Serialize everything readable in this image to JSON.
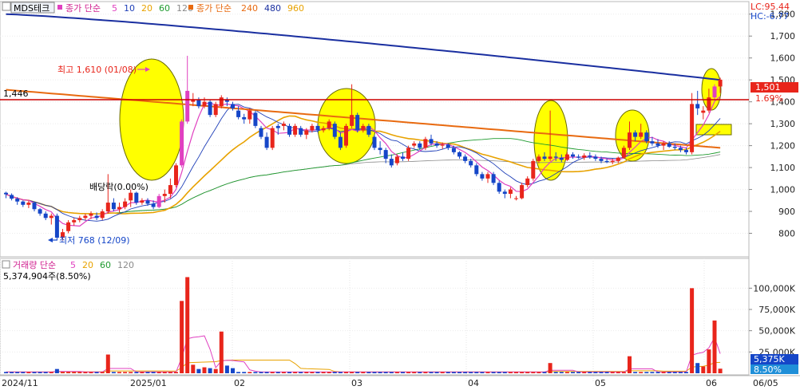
{
  "price_legend": {
    "name": "MDS테크",
    "ma_label": "종가 단순",
    "ma_periods": [
      "5",
      "10",
      "20",
      "60",
      "120"
    ],
    "ma_label_2": "종가 단순",
    "ma_periods_2": [
      "240",
      "480",
      "960"
    ]
  },
  "volume_legend": {
    "label": "거래량 단순",
    "periods": [
      "5",
      "20",
      "60",
      "120"
    ],
    "current": "5,374,904주(8.50%)"
  },
  "top_right": {
    "lc": "LC:95.44",
    "hc": "HC:-6.77"
  },
  "annotations": {
    "high": "최고 1,610 (01/08)",
    "low": "최저 768 (12/09)",
    "dividend": "배당락(0.00%)",
    "hline_label": "1,446"
  },
  "badges": {
    "price": "1,501",
    "pct": "1.69%",
    "vol": "5,375K",
    "vol_pct": "8.50%"
  },
  "colors": {
    "up": "#e8251b",
    "down": "#1546c8",
    "dividend_up": "#e040c0",
    "ma5": "#e040c0",
    "ma10": "#1f3fb8",
    "ma20": "#e8a200",
    "ma60": "#1e9a2e",
    "ma120": "#8a8a8a",
    "ma240": "#e86a10",
    "ma480": "#1a2fa0",
    "hline": "#cc0000",
    "highlight": "#ffff00"
  },
  "chart_data": {
    "type": "candlestick",
    "price_axis": {
      "min": 700,
      "max": 1850,
      "ticks": [
        "800",
        "900",
        "1,000",
        "1,100",
        "1,200",
        "1,300",
        "1,400",
        "1,500",
        "1,600",
        "1,700",
        "1,800"
      ]
    },
    "volume_axis": {
      "min": 0,
      "max": 120000,
      "ticks": [
        "25,000K",
        "50,000K",
        "75,000K",
        "100,000K"
      ]
    },
    "x_ticks": [
      "2024/11",
      "2025/01",
      "02",
      "03",
      "04",
      "05",
      "06",
      "06/05"
    ],
    "horizontal_line": 1446,
    "ohlc": [
      [
        985,
        990,
        960,
        978
      ],
      [
        975,
        982,
        950,
        958
      ],
      [
        958,
        965,
        930,
        945
      ],
      [
        945,
        950,
        920,
        930
      ],
      [
        930,
        948,
        915,
        940
      ],
      [
        940,
        945,
        900,
        910
      ],
      [
        910,
        915,
        880,
        890
      ],
      [
        890,
        900,
        860,
        870
      ],
      [
        870,
        890,
        840,
        880
      ],
      [
        880,
        890,
        770,
        780
      ],
      [
        780,
        820,
        768,
        805
      ],
      [
        810,
        860,
        800,
        850
      ],
      [
        850,
        870,
        835,
        860
      ],
      [
        860,
        880,
        850,
        870
      ],
      [
        870,
        890,
        860,
        880
      ],
      [
        880,
        900,
        865,
        890
      ],
      [
        880,
        895,
        860,
        870
      ],
      [
        870,
        910,
        860,
        900
      ],
      [
        900,
        1070,
        890,
        940
      ],
      [
        940,
        960,
        900,
        910
      ],
      [
        910,
        940,
        895,
        920
      ],
      [
        920,
        960,
        910,
        945
      ],
      [
        950,
        1000,
        920,
        985
      ],
      [
        985,
        990,
        930,
        940
      ],
      [
        940,
        960,
        930,
        950
      ],
      [
        950,
        960,
        925,
        935
      ],
      [
        935,
        950,
        910,
        920
      ],
      [
        920,
        980,
        915,
        970
      ],
      [
        970,
        1000,
        940,
        980
      ],
      [
        980,
        1050,
        960,
        1020
      ],
      [
        1020,
        1120,
        1010,
        1110
      ],
      [
        1110,
        1320,
        1100,
        1310
      ],
      [
        1310,
        1610,
        1300,
        1450
      ],
      [
        1400,
        1440,
        1380,
        1410
      ],
      [
        1410,
        1420,
        1370,
        1380
      ],
      [
        1380,
        1420,
        1370,
        1400
      ],
      [
        1400,
        1410,
        1330,
        1340
      ],
      [
        1340,
        1400,
        1330,
        1390
      ],
      [
        1380,
        1430,
        1370,
        1420
      ],
      [
        1410,
        1420,
        1380,
        1400
      ],
      [
        1390,
        1400,
        1360,
        1370
      ],
      [
        1360,
        1380,
        1320,
        1330
      ],
      [
        1330,
        1345,
        1300,
        1320
      ],
      [
        1320,
        1370,
        1300,
        1360
      ],
      [
        1350,
        1360,
        1280,
        1290
      ],
      [
        1280,
        1290,
        1230,
        1240
      ],
      [
        1240,
        1260,
        1180,
        1190
      ],
      [
        1190,
        1290,
        1180,
        1280
      ],
      [
        1290,
        1300,
        1250,
        1280
      ],
      [
        1290,
        1310,
        1270,
        1300
      ],
      [
        1290,
        1300,
        1240,
        1250
      ],
      [
        1250,
        1300,
        1240,
        1290
      ],
      [
        1280,
        1290,
        1240,
        1250
      ],
      [
        1250,
        1280,
        1230,
        1270
      ],
      [
        1270,
        1300,
        1260,
        1290
      ],
      [
        1290,
        1300,
        1260,
        1270
      ],
      [
        1270,
        1290,
        1260,
        1280
      ],
      [
        1280,
        1320,
        1270,
        1310
      ],
      [
        1300,
        1310,
        1230,
        1240
      ],
      [
        1240,
        1260,
        1180,
        1190
      ],
      [
        1200,
        1300,
        1190,
        1290
      ],
      [
        1290,
        1480,
        1280,
        1340
      ],
      [
        1340,
        1350,
        1260,
        1270
      ],
      [
        1270,
        1300,
        1260,
        1290
      ],
      [
        1290,
        1300,
        1240,
        1250
      ],
      [
        1240,
        1250,
        1180,
        1190
      ],
      [
        1190,
        1220,
        1160,
        1180
      ],
      [
        1180,
        1190,
        1120,
        1140
      ],
      [
        1140,
        1160,
        1100,
        1110
      ],
      [
        1120,
        1160,
        1110,
        1150
      ],
      [
        1150,
        1170,
        1130,
        1140
      ],
      [
        1140,
        1200,
        1130,
        1190
      ],
      [
        1200,
        1220,
        1190,
        1210
      ],
      [
        1210,
        1220,
        1180,
        1190
      ],
      [
        1190,
        1240,
        1180,
        1230
      ],
      [
        1230,
        1250,
        1200,
        1210
      ],
      [
        1210,
        1220,
        1190,
        1200
      ],
      [
        1200,
        1215,
        1185,
        1205
      ],
      [
        1205,
        1210,
        1180,
        1190
      ],
      [
        1190,
        1200,
        1160,
        1170
      ],
      [
        1170,
        1175,
        1140,
        1150
      ],
      [
        1150,
        1160,
        1120,
        1130
      ],
      [
        1130,
        1140,
        1100,
        1110
      ],
      [
        1110,
        1120,
        1060,
        1070
      ],
      [
        1070,
        1080,
        1040,
        1050
      ],
      [
        1050,
        1080,
        1030,
        1070
      ],
      [
        1070,
        1080,
        1020,
        1030
      ],
      [
        1030,
        1040,
        980,
        990
      ],
      [
        990,
        1000,
        960,
        980
      ],
      [
        980,
        1010,
        960,
        1000
      ],
      [
        960,
        970,
        950,
        960
      ],
      [
        960,
        1030,
        955,
        1020
      ],
      [
        1020,
        1060,
        1010,
        1050
      ],
      [
        1050,
        1140,
        1040,
        1130
      ],
      [
        1130,
        1160,
        1120,
        1150
      ],
      [
        1150,
        1170,
        1130,
        1140
      ],
      [
        1140,
        1360,
        1130,
        1150
      ],
      [
        1150,
        1170,
        1130,
        1145
      ],
      [
        1145,
        1160,
        1125,
        1135
      ],
      [
        1135,
        1170,
        1130,
        1160
      ],
      [
        1160,
        1170,
        1140,
        1150
      ],
      [
        1150,
        1160,
        1140,
        1145
      ],
      [
        1145,
        1165,
        1135,
        1155
      ],
      [
        1155,
        1170,
        1140,
        1150
      ],
      [
        1150,
        1160,
        1130,
        1140
      ],
      [
        1140,
        1150,
        1120,
        1130
      ],
      [
        1130,
        1140,
        1120,
        1125
      ],
      [
        1125,
        1140,
        1115,
        1130
      ],
      [
        1130,
        1150,
        1120,
        1145
      ],
      [
        1145,
        1200,
        1140,
        1190
      ],
      [
        1190,
        1310,
        1180,
        1260
      ],
      [
        1260,
        1270,
        1220,
        1240
      ],
      [
        1240,
        1300,
        1230,
        1260
      ],
      [
        1260,
        1270,
        1210,
        1220
      ],
      [
        1220,
        1240,
        1200,
        1210
      ],
      [
        1210,
        1230,
        1190,
        1200
      ],
      [
        1200,
        1220,
        1180,
        1210
      ],
      [
        1210,
        1220,
        1190,
        1195
      ],
      [
        1195,
        1210,
        1180,
        1190
      ],
      [
        1190,
        1200,
        1170,
        1180
      ],
      [
        1180,
        1190,
        1160,
        1170
      ],
      [
        1170,
        1440,
        1160,
        1390
      ],
      [
        1390,
        1450,
        1340,
        1370
      ],
      [
        1350,
        1380,
        1320,
        1360
      ],
      [
        1360,
        1460,
        1350,
        1420
      ],
      [
        1420,
        1480,
        1410,
        1470
      ],
      [
        1470,
        1510,
        1440,
        1501
      ]
    ],
    "volume": [
      1500,
      1500,
      1500,
      1500,
      1500,
      1500,
      1500,
      1500,
      1500,
      5000,
      1500,
      1500,
      1500,
      1500,
      1500,
      1500,
      1500,
      1500,
      22000,
      1500,
      1500,
      1500,
      1500,
      1500,
      1500,
      1500,
      1500,
      1500,
      1500,
      1500,
      1500,
      85000,
      113000,
      10000,
      5000,
      7000,
      6000,
      5000,
      49000,
      9000,
      6000,
      1500,
      1500,
      1500,
      1500,
      1500,
      1500,
      1500,
      1500,
      1500,
      1500,
      1500,
      1500,
      1500,
      1500,
      1500,
      1500,
      1500,
      1500,
      1500,
      1500,
      1500,
      1500,
      1500,
      1500,
      1500,
      1500,
      1500,
      1500,
      1500,
      1500,
      1500,
      1500,
      1500,
      1500,
      1500,
      1500,
      1500,
      1500,
      1500,
      1500,
      1500,
      1500,
      1500,
      1500,
      1500,
      1500,
      1500,
      1500,
      1500,
      1500,
      1500,
      1500,
      1500,
      1500,
      1500,
      12000,
      1500,
      1500,
      1500,
      1500,
      1500,
      1500,
      1500,
      1500,
      1500,
      1500,
      1500,
      1500,
      1500,
      20000,
      1500,
      1500,
      1500,
      1500,
      1500,
      1500,
      1500,
      1500,
      1500,
      1500,
      100000,
      12000,
      8000,
      28000,
      62000,
      5375
    ],
    "dividend_index": 27,
    "high_index": 32,
    "low_index": 9
  }
}
